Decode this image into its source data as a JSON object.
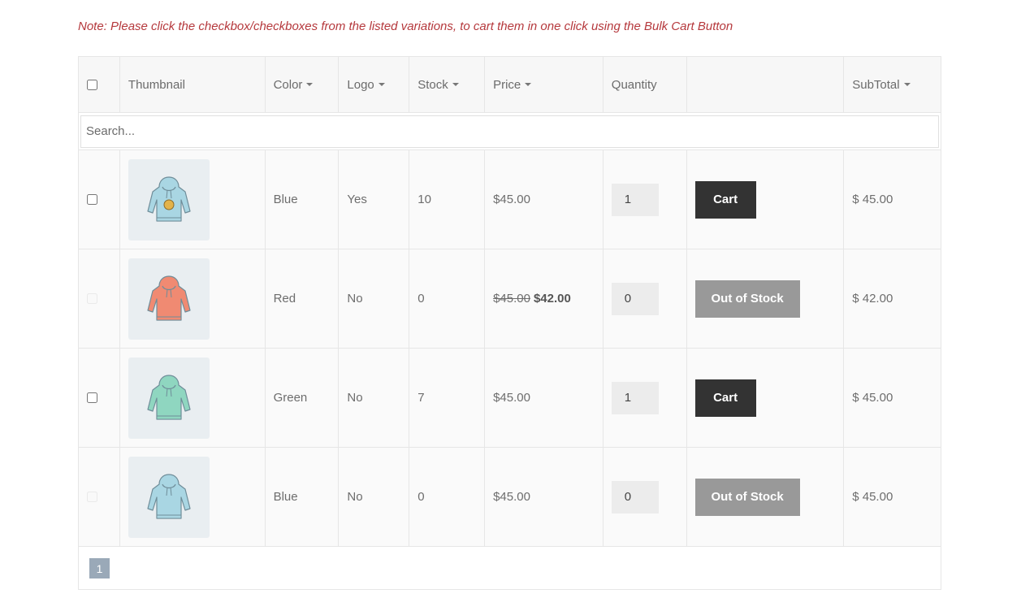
{
  "note": "Note: Please click the checkbox/checkboxes from the listed variations, to cart them in one click using the Bulk Cart Button",
  "headers": {
    "thumbnail": "Thumbnail",
    "color": "Color",
    "logo": "Logo",
    "stock": "Stock",
    "price": "Price",
    "quantity": "Quantity",
    "subtotal": "SubTotal"
  },
  "search": {
    "placeholder": "Search..."
  },
  "rows": [
    {
      "color": "Blue",
      "logo": "Yes",
      "stock": "10",
      "price": "$45.00",
      "qty": "1",
      "action": "Cart",
      "subtotal": "$ 45.00",
      "hoodie_color": "#a9d6e3",
      "checkbox_enabled": true
    },
    {
      "color": "Red",
      "logo": "No",
      "stock": "0",
      "price_old": "$45.00",
      "price_new": "$42.00",
      "qty": "0",
      "action": "Out of Stock",
      "subtotal": "$ 42.00",
      "hoodie_color": "#f08a72",
      "checkbox_enabled": false
    },
    {
      "color": "Green",
      "logo": "No",
      "stock": "7",
      "price": "$45.00",
      "qty": "1",
      "action": "Cart",
      "subtotal": "$ 45.00",
      "hoodie_color": "#8fd6c0",
      "checkbox_enabled": true
    },
    {
      "color": "Blue",
      "logo": "No",
      "stock": "0",
      "price": "$45.00",
      "qty": "0",
      "action": "Out of Stock",
      "subtotal": "$ 45.00",
      "hoodie_color": "#a9d6e3",
      "checkbox_enabled": false
    }
  ],
  "pagination": {
    "current": "1"
  },
  "colors": {
    "note": "#b5383c",
    "cart_button": "#333333",
    "oos_button": "#999999",
    "page_badge": "#9aa9b8"
  }
}
